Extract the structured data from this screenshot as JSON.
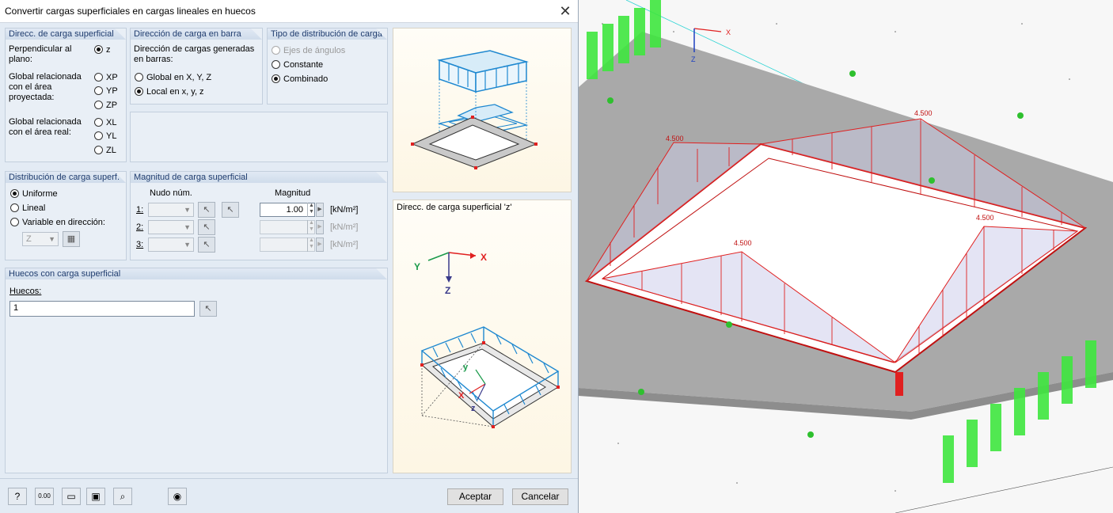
{
  "dialog": {
    "title": "Convertir cargas superficiales en cargas lineales en huecos",
    "close": "✕"
  },
  "surface_dir": {
    "title": "Direcc. de carga superficial",
    "perp_label": "Perpendicular al plano:",
    "perp_option": "z",
    "proj_label": "Global relacionada con el área proyectada:",
    "proj_options": [
      "XP",
      "YP",
      "ZP"
    ],
    "real_label": "Global relacionada con el área real:",
    "real_options": [
      "XL",
      "YL",
      "ZL"
    ],
    "selected": "z"
  },
  "member_dir": {
    "title": "Dirección de carga en barra",
    "desc": "Dirección de cargas generadas en barras:",
    "options": [
      "Global en X, Y, Z",
      "Local en x, y, z"
    ],
    "selected": "Local en x, y, z"
  },
  "dist_type": {
    "title": "Tipo de distribución de carga",
    "options": [
      "Ejes de ángulos",
      "Constante",
      "Combinado"
    ],
    "selected": "Combinado"
  },
  "surf_dist": {
    "title": "Distribución de carga superf.",
    "options": [
      "Uniforme",
      "Lineal",
      "Variable en dirección:"
    ],
    "selected": "Uniforme",
    "direction_value": "Z"
  },
  "magnitude": {
    "title": "Magnitud de carga superficial",
    "col_node": "Nudo núm.",
    "col_mag": "Magnitud",
    "rows": [
      {
        "label": "1:",
        "value": "1.00",
        "unit": "[kN/m²]"
      },
      {
        "label": "2:",
        "value": "",
        "unit": "[kN/m²]"
      },
      {
        "label": "3:",
        "value": "",
        "unit": "[kN/m²]"
      }
    ]
  },
  "openings": {
    "title": "Huecos con carga superficial",
    "label": "Huecos:",
    "value": "1"
  },
  "preview": {
    "caption": "Direcc. de carga superficial 'z'"
  },
  "buttons": {
    "accept": "Aceptar",
    "cancel": "Cancelar"
  },
  "viewport": {
    "labels": [
      "4.500",
      "4.500",
      "4.500",
      "4.500"
    ],
    "axis_x": "X",
    "axis_z": "Z"
  },
  "colors": {
    "accent": "#1f3c6e",
    "load": "#e02020",
    "support": "#3ee63e",
    "slab": "#a8a8a8"
  }
}
